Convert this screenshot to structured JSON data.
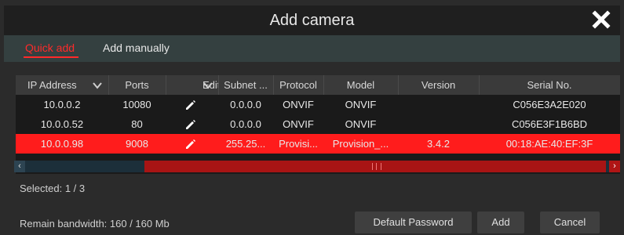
{
  "dialog": {
    "title": "Add camera",
    "close_icon": "close-icon"
  },
  "tabs": [
    {
      "label": "Quick add",
      "active": true,
      "color": "#ff2a2a"
    },
    {
      "label": "Add manually",
      "active": false
    }
  ],
  "table": {
    "columns": [
      "IP Address",
      "Ports",
      "Edit",
      "Subnet ...",
      "Protocol",
      "Model",
      "Version",
      "Serial No."
    ],
    "rows": [
      {
        "ip": "10.0.0.2",
        "ports": "10080",
        "subnet": "0.0.0.0",
        "protocol": "ONVIF",
        "model": "ONVIF",
        "version": "",
        "serial": "C056E3A2E020",
        "selected": false
      },
      {
        "ip": "10.0.0.52",
        "ports": "80",
        "subnet": "0.0.0.0",
        "protocol": "ONVIF",
        "model": "ONVIF",
        "version": "",
        "serial": "C056E3F1B6BD",
        "selected": false
      },
      {
        "ip": "10.0.0.98",
        "ports": "9008",
        "subnet": "255.25...",
        "protocol": "Provisi...",
        "model": "Provision_...",
        "version": "3.4.2",
        "serial": "00:18:AE:40:EF:3F",
        "selected": true
      }
    ],
    "selection_color": "#ff1c1c"
  },
  "footer": {
    "selected": "Selected: 1 / 3",
    "bandwidth": "Remain bandwidth: 160 / 160 Mb",
    "buttons": {
      "default_password": "Default Password",
      "add": "Add",
      "cancel": "Cancel"
    }
  }
}
